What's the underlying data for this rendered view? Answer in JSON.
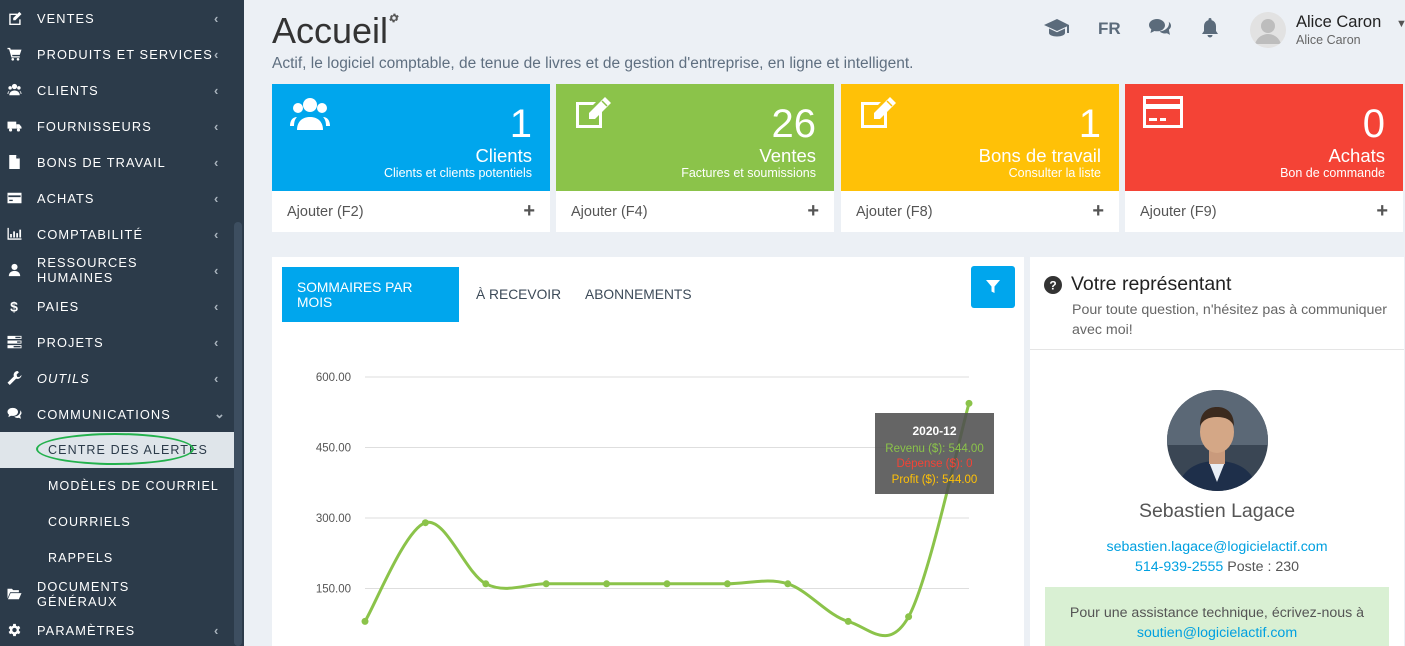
{
  "sidebar": {
    "items": [
      {
        "label": "VENTES",
        "icon": "edit-icon"
      },
      {
        "label": "PRODUITS ET SERVICES",
        "icon": "cart-icon"
      },
      {
        "label": "CLIENTS",
        "icon": "users-icon"
      },
      {
        "label": "FOURNISSEURS",
        "icon": "truck-icon"
      },
      {
        "label": "BONS DE TRAVAIL",
        "icon": "file-icon"
      },
      {
        "label": "ACHATS",
        "icon": "credit-card-icon"
      },
      {
        "label": "COMPTABILITÉ",
        "icon": "bar-chart-icon"
      },
      {
        "label": "RESSOURCES HUMAINES",
        "icon": "user-icon"
      },
      {
        "label": "PAIES",
        "icon": "dollar-icon"
      },
      {
        "label": "PROJETS",
        "icon": "tasks-icon"
      },
      {
        "label": "OUTILS",
        "icon": "wrench-icon"
      },
      {
        "label": "COMMUNICATIONS",
        "icon": "comments-icon"
      }
    ],
    "sub_items": [
      "CENTRE DES ALERTES",
      "MODÈLES DE COURRIEL",
      "COURRIELS",
      "RAPPELS"
    ],
    "bottom_items": [
      {
        "label": "DOCUMENTS GÉNÉRAUX",
        "icon": "folder-open-icon"
      },
      {
        "label": "PARAMÈTRES",
        "icon": "gear-icon"
      }
    ],
    "chev_right": "‹",
    "chev_down": "⌄"
  },
  "header": {
    "title": "Accueil",
    "subtitle": "Actif, le logiciel comptable, de tenue de livres et de gestion d'entreprise, en ligne et intelligent.",
    "lang": "FR",
    "user_name": "Alice Caron",
    "user_sub": "Alice Caron"
  },
  "cards": [
    {
      "num": "1",
      "title": "Clients",
      "desc": "Clients et clients potentiels",
      "action": "Ajouter (F2)",
      "color": "#00a6ed",
      "icon": "users-icon"
    },
    {
      "num": "26",
      "title": "Ventes",
      "desc": "Factures et soumissions",
      "action": "Ajouter (F4)",
      "color": "#8bc34a",
      "icon": "edit-icon"
    },
    {
      "num": "1",
      "title": "Bons de travail",
      "desc": "Consulter la liste",
      "action": "Ajouter (F8)",
      "color": "#ffc107",
      "icon": "edit-icon"
    },
    {
      "num": "0",
      "title": "Achats",
      "desc": "Bon de commande",
      "action": "Ajouter (F9)",
      "color": "#f44336",
      "icon": "credit-card-icon"
    }
  ],
  "tabs": [
    "SOMMAIRES PAR MOIS",
    "À RECEVOIR",
    "ABONNEMENTS"
  ],
  "chart_data": {
    "type": "line",
    "y_ticks": [
      "600.00",
      "450.00",
      "300.00",
      "150.00"
    ],
    "ylim": [
      0,
      600
    ],
    "grid": true,
    "series": [
      {
        "name": "Revenu ($)",
        "color": "#8bc34a",
        "values": [
          80,
          290,
          160,
          160,
          160,
          160,
          160,
          160,
          80,
          90,
          544
        ]
      }
    ],
    "tooltip": {
      "date": "2020-12",
      "revenu": "Revenu ($): 544.00",
      "depense": "Dépense ($): 0",
      "profit": "Profit ($): 544.00"
    }
  },
  "rep": {
    "title": "Votre représentant",
    "desc": "Pour toute question, n'hésitez pas à communiquer avec moi!",
    "name": "Sebastien Lagace",
    "email": "sebastien.lagace@logicielactif.com",
    "phone": "514-939-2555",
    "ext": "Poste : 230",
    "support_text": "Pour une assistance technique, écrivez-nous à",
    "support_email": "soutien@logicielactif.com"
  }
}
